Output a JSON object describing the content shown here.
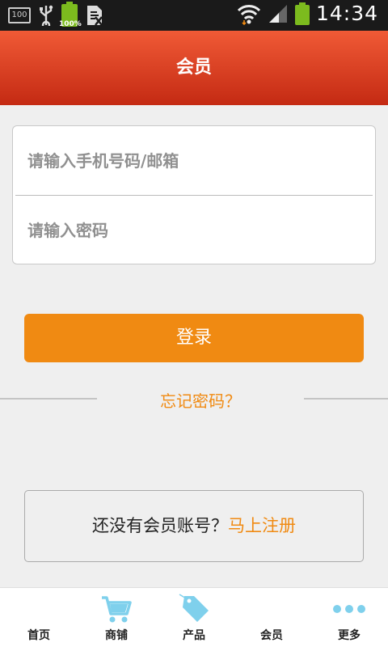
{
  "status_bar": {
    "notification_badge": "100",
    "battery_small_pct": "100%",
    "time": "14:34"
  },
  "header": {
    "title": "会员"
  },
  "login_form": {
    "phone_placeholder": "请输入手机号码/邮箱",
    "password_placeholder": "请输入密码",
    "login_button": "登录",
    "forgot_password": "忘记密码？"
  },
  "register": {
    "prompt": "还没有会员账号？",
    "link": "马上注册"
  },
  "tab_bar": {
    "items": [
      {
        "label": "首页",
        "icon": "home-icon"
      },
      {
        "label": "商铺",
        "icon": "shopping-cart-icon"
      },
      {
        "label": "产品",
        "icon": "sale-tag-icon"
      },
      {
        "label": "会员",
        "icon": "member-icon"
      },
      {
        "label": "更多",
        "icon": "more-dots-icon"
      }
    ]
  },
  "colors": {
    "accent": "#f08a12",
    "header_top": "#f05a36",
    "header_bottom": "#c42a13",
    "tab_icon": "#7fd0ec"
  }
}
